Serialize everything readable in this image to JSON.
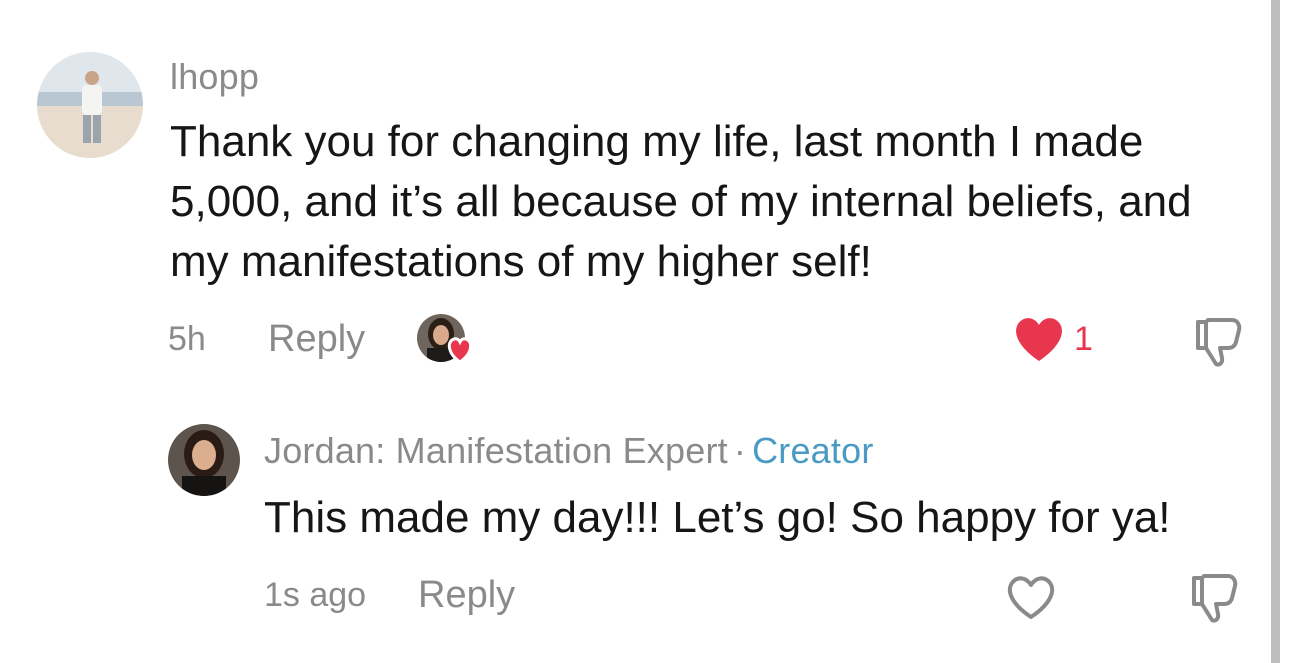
{
  "comment": {
    "username": "lhopp",
    "text": "Thank you for changing my life, last month I made 5,000, and it’s all because of my internal beliefs, and my manifestations of my higher self!",
    "time": "5h",
    "reply_label": "Reply",
    "like_count": "1",
    "liked_by_creator": true
  },
  "reply": {
    "username": "Jordan: Manifestation Expert",
    "separator": "·",
    "creator_label": "Creator",
    "text": "This made my day!!! Let’s go! So happy for ya!",
    "time": "1s ago",
    "reply_label": "Reply"
  },
  "colors": {
    "like_red": "#e8364f",
    "creator_blue": "#4a9ac4",
    "meta_gray": "#8a8a8a"
  },
  "icons": {
    "like": "heart-icon",
    "dislike": "thumbs-down-icon",
    "creator_like": "creator-liked-heart-icon"
  }
}
